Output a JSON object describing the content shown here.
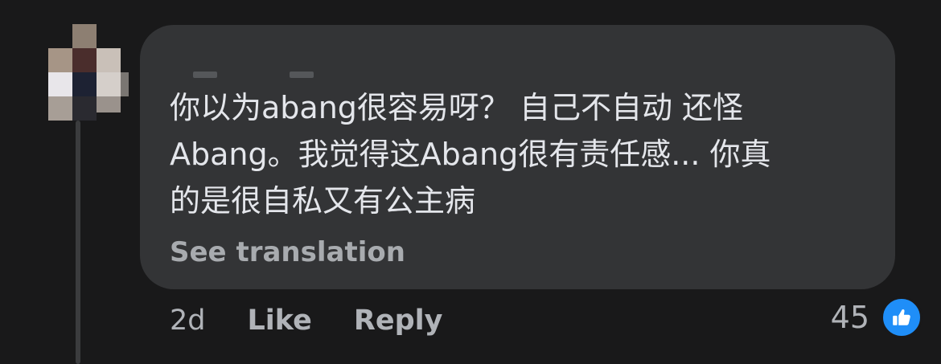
{
  "comment": {
    "text": "你以为abang很容易呀？  自己不自动 还怪\n Abang。我觉得这Abang很有责任感... 你真\n的是很自私又有公主病",
    "see_translation_label": "See translation"
  },
  "meta": {
    "time": "2d",
    "like_label": "Like",
    "reply_label": "Reply"
  },
  "reactions": {
    "count": "45",
    "icon": "thumbs-up-icon",
    "color": "#1f8ef8"
  }
}
